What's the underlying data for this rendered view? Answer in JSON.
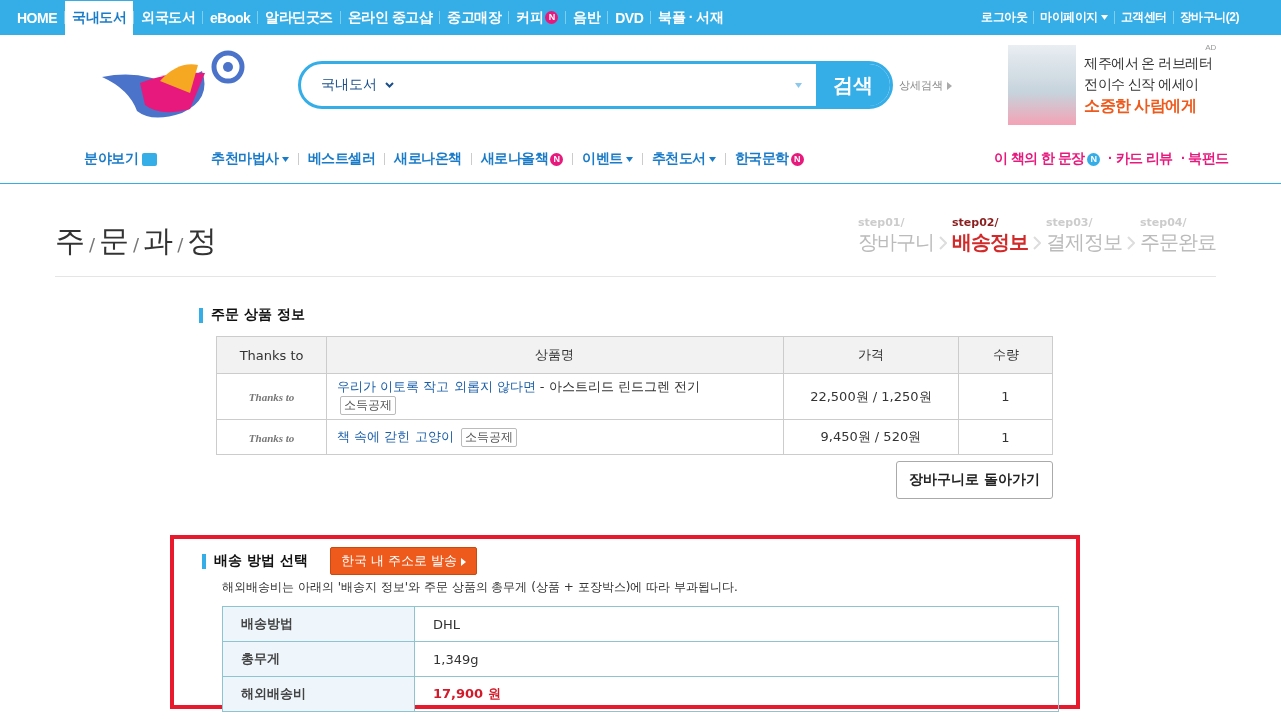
{
  "top_nav": {
    "left": [
      {
        "label": "HOME",
        "selected": false
      },
      {
        "label": "국내도서",
        "selected": true
      },
      {
        "label": "외국도서",
        "selected": false
      },
      {
        "label": "eBook",
        "selected": false
      },
      {
        "label": "알라딘굿즈",
        "selected": false
      },
      {
        "label": "온라인 중고샵",
        "selected": false
      },
      {
        "label": "중고매장",
        "selected": false
      },
      {
        "label": "커피",
        "selected": false,
        "badge": "N"
      },
      {
        "label": "음반",
        "selected": false
      },
      {
        "label": "DVD",
        "selected": false
      },
      {
        "label": "북플 · 서재",
        "selected": false
      }
    ],
    "right": [
      {
        "label": "로그아웃",
        "dropdown": false
      },
      {
        "label": "마이페이지",
        "dropdown": true
      },
      {
        "label": "고객센터",
        "dropdown": false
      },
      {
        "label": "장바구니(2)",
        "dropdown": false
      }
    ]
  },
  "search": {
    "category": "국내도서",
    "button": "검색",
    "advanced": "상세검색"
  },
  "ad": {
    "tag": "AD",
    "lines": [
      {
        "text": "제주에서 온 러브레터",
        "highlight": false
      },
      {
        "text": "전이수 신작 에세이",
        "highlight": false
      },
      {
        "text": "소중한 사람에게",
        "highlight": true
      }
    ]
  },
  "sub_nav": {
    "category": "분야보기",
    "items": [
      {
        "label": "추천마법사",
        "dropdown": true
      },
      {
        "label": "베스트셀러",
        "dropdown": false
      },
      {
        "label": "새로나온책",
        "dropdown": false
      },
      {
        "label": "새로나올책",
        "dropdown": false,
        "badge": "N"
      },
      {
        "label": "이벤트",
        "dropdown": true
      },
      {
        "label": "추천도서",
        "dropdown": true
      },
      {
        "label": "한국문학",
        "dropdown": false,
        "badge": "N"
      }
    ],
    "right": [
      {
        "label": "이 책의 한 문장",
        "badge": "N"
      },
      {
        "label": "· 카드 리뷰"
      },
      {
        "label": "· 북펀드"
      }
    ]
  },
  "page_title": {
    "chars": [
      "주",
      "문",
      "과",
      "정"
    ],
    "separator": "/"
  },
  "steps": [
    {
      "step": "step01/",
      "label": "장바구니",
      "selected": false
    },
    {
      "step": "step02/",
      "label": "배송정보",
      "selected": true
    },
    {
      "step": "step03/",
      "label": "결제정보",
      "selected": false
    },
    {
      "step": "step04/",
      "label": "주문완료",
      "selected": false
    }
  ],
  "order_items": {
    "heading": "주문 상품 정보",
    "columns": [
      "Thanks to",
      "상품명",
      "가격",
      "수량"
    ],
    "rows": [
      {
        "thanks": "Thanks to",
        "title": "우리가 이토록 작고 외롭지 않다면",
        "subtitle": " - 아스트리드 린드그렌 전기",
        "tag": "소득공제",
        "price": "22,500원 / 1,250원",
        "qty": "1"
      },
      {
        "thanks": "Thanks to",
        "title": "책 속에 갇힌 고양이",
        "subtitle": "",
        "tag": "소득공제",
        "price": "9,450원 / 520원",
        "qty": "1"
      }
    ],
    "back_button": "장바구니로 돌아가기"
  },
  "shipping": {
    "highlighted": true,
    "heading": "배송 방법 선택",
    "domestic_button": "한국 내 주소로 발송",
    "note": "해외배송비는 아래의 '배송지 정보'와 주문 상품의 총무게 (상품 + 포장박스)에 따라 부과됩니다.",
    "rows": [
      {
        "label": "배송방법",
        "value": "DHL",
        "emphasis": false
      },
      {
        "label": "총무게",
        "value": "1,349g",
        "emphasis": false
      },
      {
        "label": "해외배송비",
        "value": "17,900 원",
        "emphasis": true
      }
    ]
  }
}
